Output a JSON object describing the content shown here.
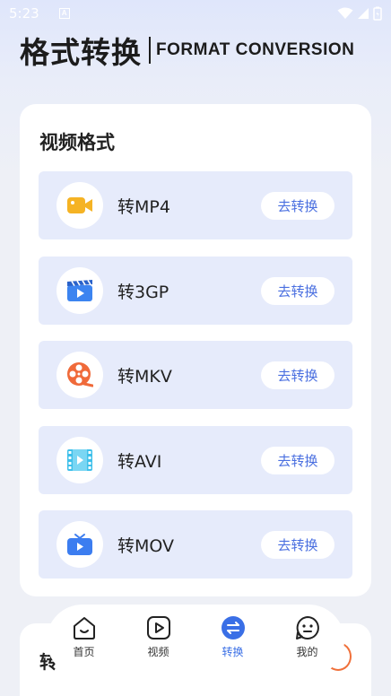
{
  "status_bar": {
    "time": "5:23",
    "notification_icon": "A"
  },
  "header": {
    "title": "格式转换",
    "subtitle": "FORMAT CONVERSION"
  },
  "section": {
    "title": "视频格式",
    "items": [
      {
        "label": "转MP4",
        "button": "去转换",
        "icon": "video-camera-icon",
        "color": "#f5b324"
      },
      {
        "label": "转3GP",
        "button": "去转换",
        "icon": "clapperboard-icon",
        "color": "#3c84f0"
      },
      {
        "label": "转MKV",
        "button": "去转换",
        "icon": "film-reel-icon",
        "color": "#f06a3a"
      },
      {
        "label": "转AVI",
        "button": "去转换",
        "icon": "film-strip-icon",
        "color": "#3fc0ea"
      },
      {
        "label": "转MOV",
        "button": "去转换",
        "icon": "tv-icon",
        "color": "#3c7df0"
      }
    ]
  },
  "bottom_peek": {
    "char": "转"
  },
  "tabbar": {
    "tabs": [
      {
        "label": "首页",
        "icon": "home-smile-icon"
      },
      {
        "label": "视频",
        "icon": "play-icon"
      },
      {
        "label": "转换",
        "icon": "convert-icon",
        "active": true
      },
      {
        "label": "我的",
        "icon": "profile-face-icon"
      }
    ]
  },
  "colors": {
    "accent": "#3a6fe6",
    "item_bg": "#e6ebfb",
    "button_text": "#4a6fe0"
  }
}
